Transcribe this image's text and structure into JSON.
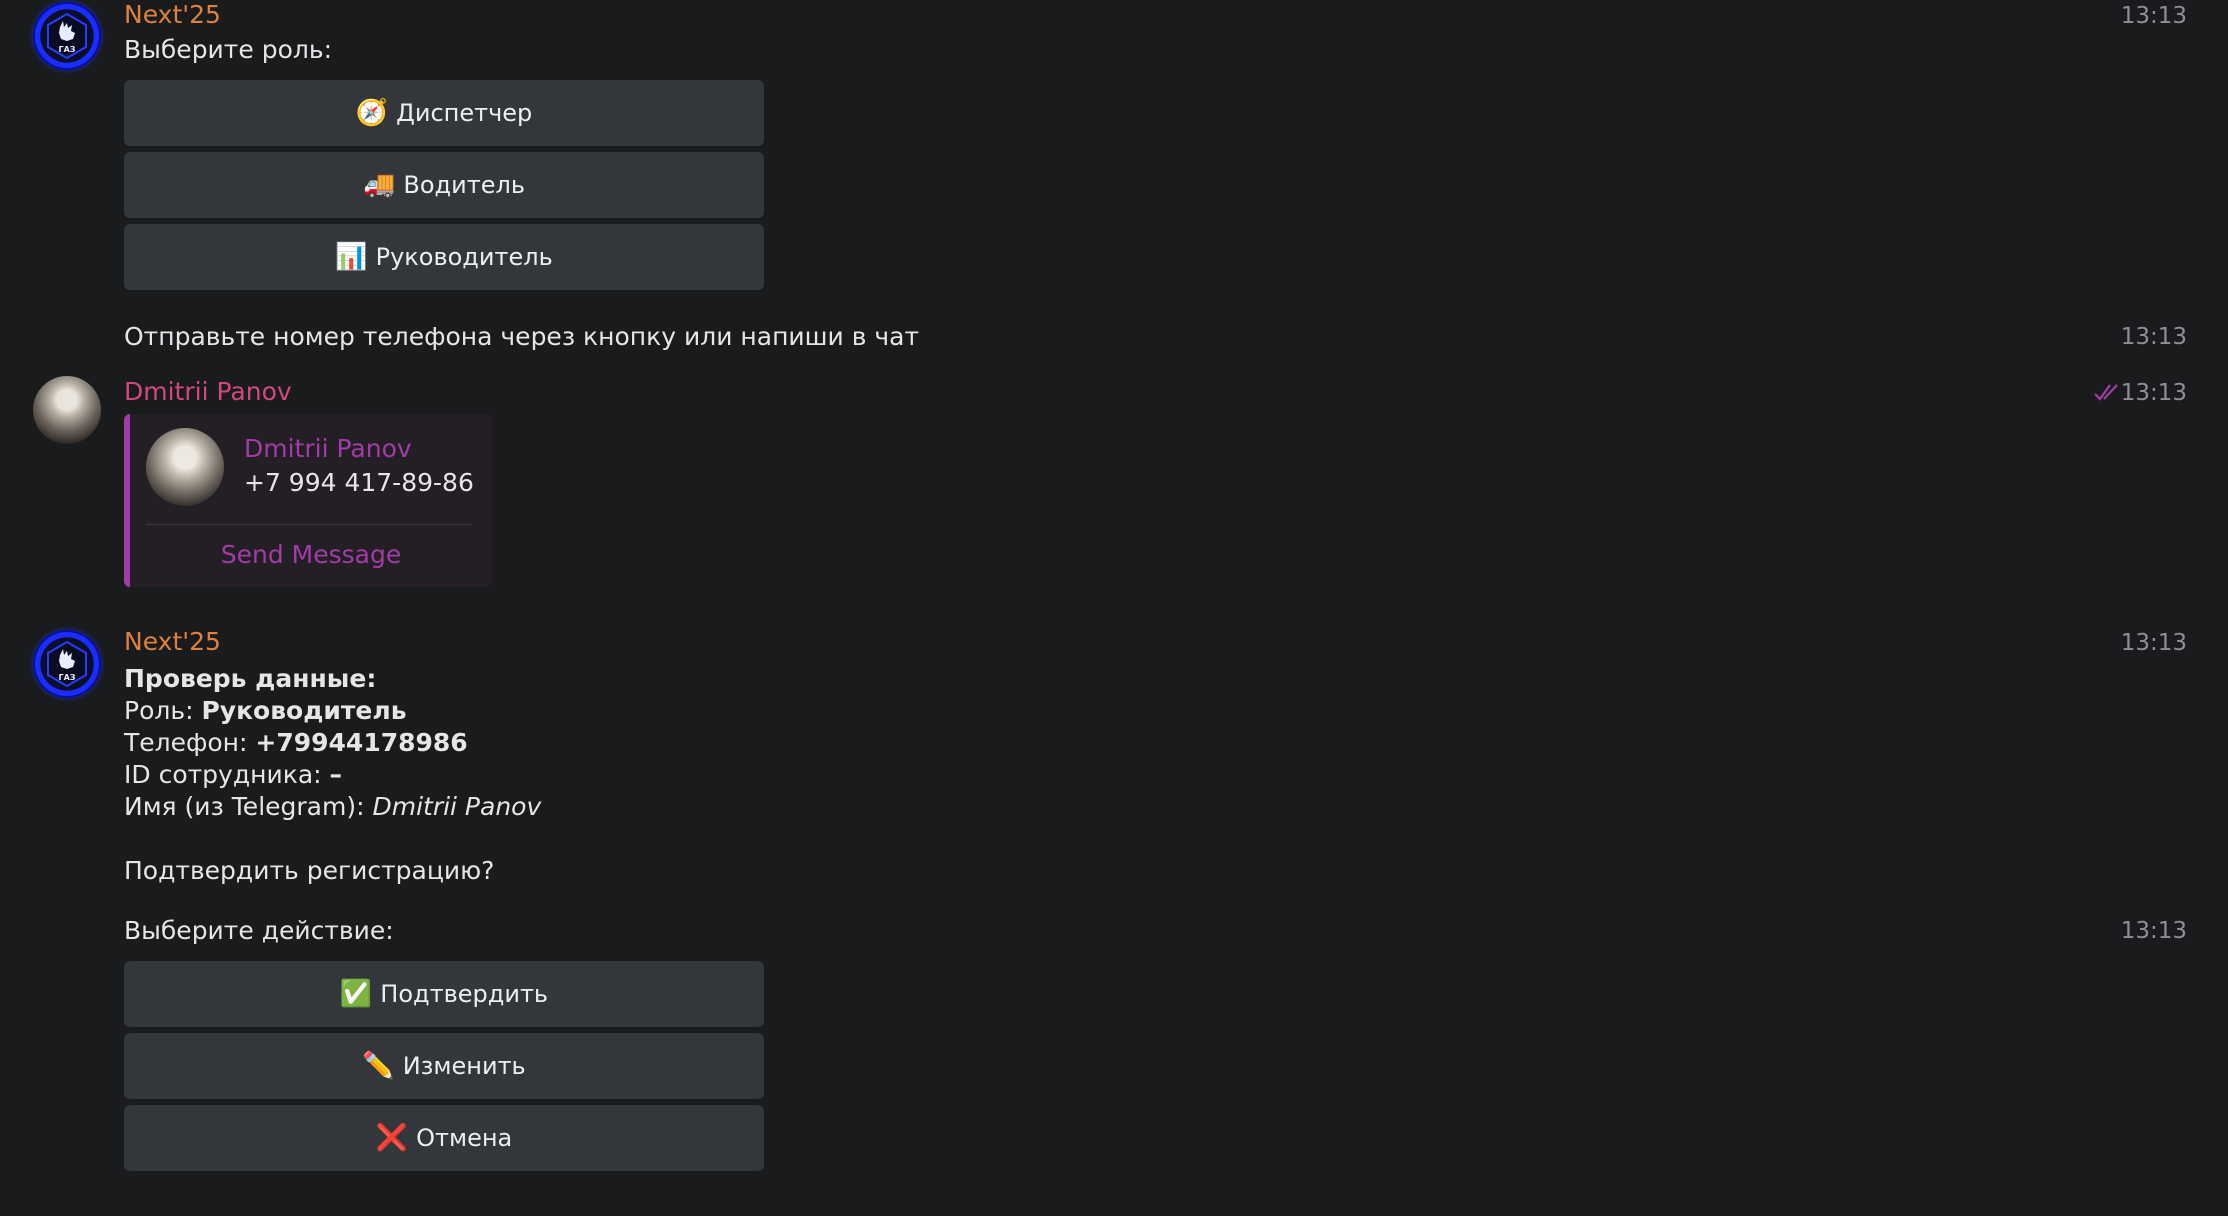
{
  "messages": {
    "m1": {
      "sender": "Next'25",
      "time": "13:13",
      "text": "Выберите роль:",
      "buttons": [
        {
          "emoji": "🧭",
          "label": "Диспетчер"
        },
        {
          "emoji": "🚚",
          "label": "Водитель"
        },
        {
          "emoji": "📊",
          "label": "Руководитель"
        }
      ]
    },
    "m2": {
      "text": "Отправьте номер телефона через кнопку или напиши в чат",
      "time": "13:13"
    },
    "m3": {
      "sender": "Dmitrii Panov",
      "time": "13:13",
      "contact": {
        "name": "Dmitrii Panov",
        "phone": "+7 994 417-89-86",
        "action": "Send Message"
      }
    },
    "m4": {
      "sender": "Next'25",
      "time": "13:13",
      "heading": "Проверь данные:",
      "role_label": "Роль: ",
      "role_value": "Руководитель",
      "phone_label": "Телефон: ",
      "phone_value": "+79944178986",
      "id_label": "ID сотрудника: ",
      "id_value": "–",
      "name_label": "Имя (из Telegram): ",
      "name_value": "Dmitrii Panov",
      "question": "Подтвердить регистрацию?"
    },
    "m5": {
      "text": "Выберите действие:",
      "time": "13:13",
      "buttons": [
        {
          "emoji": "✅",
          "label": "Подтвердить"
        },
        {
          "emoji": "✏️",
          "label": "Изменить"
        },
        {
          "emoji": "❌",
          "label": "Отмена"
        }
      ]
    }
  },
  "colors": {
    "background": "#1a1b1d",
    "bot_name": "#e0803c",
    "user_name": "#d2487a",
    "contact_accent": "#a13ca8",
    "button_bg": "#33363b",
    "time": "#8d8f94"
  },
  "icons": {
    "bot_avatar": "gaz-deer-logo-icon",
    "user_avatar": "user-photo-avatar",
    "read_status": "double-check-icon"
  }
}
